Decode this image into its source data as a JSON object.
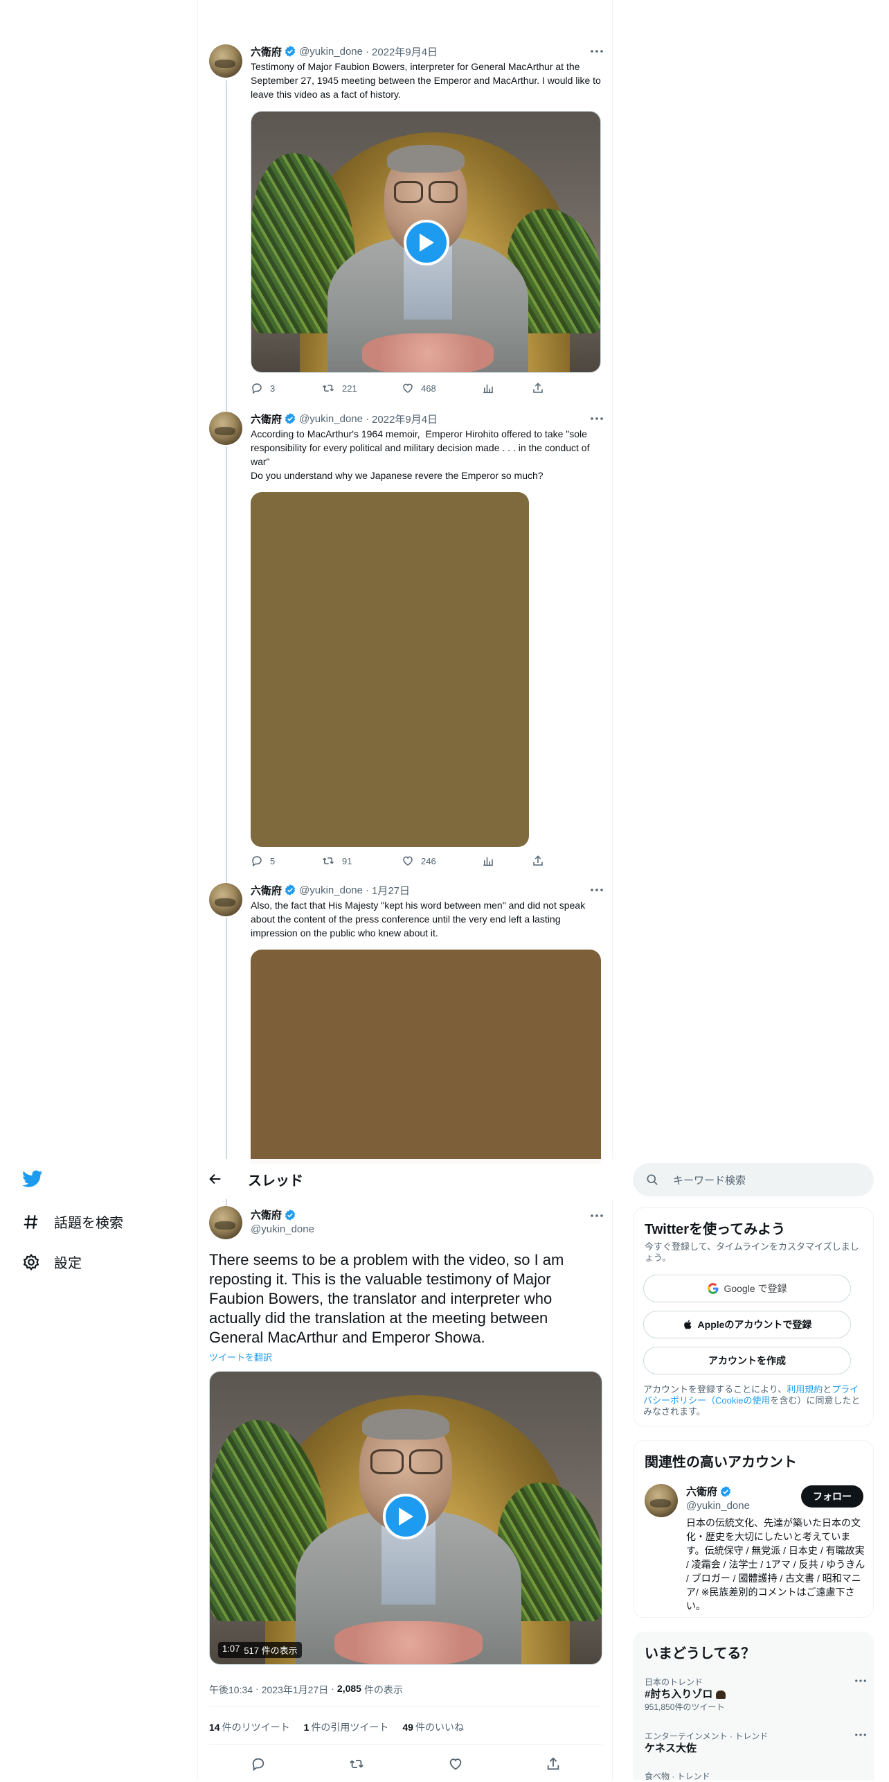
{
  "sidebar": {
    "explore_label": "話題を検索",
    "settings_label": "設定"
  },
  "header": {
    "title": "スレッド"
  },
  "tweets": [
    {
      "name": "六衛府",
      "handle": "@yukin_done",
      "date": "2022年9月4日",
      "text": "Testimony of Major Faubion Bowers, interpreter for General MacArthur at the September 27, 1945 meeting between the Emperor and MacArthur. I would like to leave this video as a fact of history.",
      "replies": "3",
      "retweets": "221",
      "likes": "468"
    },
    {
      "name": "六衛府",
      "handle": "@yukin_done",
      "date": "2022年9月4日",
      "text": "According to MacArthur's 1964 memoir,  Emperor Hirohito offered to take \"sole responsibility for every political and military decision made . . . in the conduct of war\"\nDo you understand why we Japanese revere the Emperor so much?",
      "replies": "5",
      "retweets": "91",
      "likes": "246",
      "media_color": "#7e6a3d"
    },
    {
      "name": "六衛府",
      "handle": "@yukin_done",
      "date": "1月27日",
      "text": "Also, the fact that His Majesty \"kept his word between men\" and did not speak about the content of the press conference until the very end left a lasting impression on the public who knew about it.",
      "media_color": "#7d5f3a"
    }
  ],
  "main_tweet": {
    "name": "六衛府",
    "handle": "@yukin_done",
    "text": "There seems to be a problem with the video, so I am reposting it. This is the valuable testimony of Major Faubion Bowers, the translator and interpreter who actually did the translation at the meeting between General MacArthur and Emperor Showa.",
    "translate": "ツイートを翻訳",
    "video_duration": "1:07",
    "video_views": "517 件の表示",
    "time": "午後10:34",
    "date": "2023年1月27日",
    "views_count": "2,085",
    "views_label": "件の表示",
    "retweets_count": "14",
    "retweets_label": "件のリツイート",
    "quotes_count": "1",
    "quotes_label": "件の引用ツイート",
    "likes_count": "49",
    "likes_label": "件のいいね"
  },
  "search": {
    "placeholder": "キーワード検索"
  },
  "signup": {
    "title": "Twitterを使ってみよう",
    "subtitle": "今すぐ登録して、タイムラインをカスタマイズしましょう。",
    "google": "Google で登録",
    "apple": "Appleのアカウントで登録",
    "create": "アカウントを作成",
    "legal_1": "アカウントを登録することにより、",
    "legal_terms": "利用規約",
    "legal_2": "と",
    "legal_privacy": "プライバシーポリシー（Cookieの使用",
    "legal_3": "を含む）に同意したとみなされます。"
  },
  "relevant": {
    "title": "関連性の高いアカウント",
    "name": "六衛府",
    "handle": "@yukin_done",
    "follow": "フォロー",
    "bio": "日本の伝統文化、先達が築いた日本の文化・歴史を大切にしたいと考えています。伝統保守 / 無党派 / 日本史 / 有職故実 / 凌霜会 / 法学士 / 1アマ / 反共 / ゆうきん / ブロガー / 國體護持 / 古文書 / 昭和マニア/ ※民族差別的コメントはご遠慮下さい。"
  },
  "trends": {
    "title": "いまどうしてる？",
    "items": [
      {
        "context": "日本のトレンド",
        "name": "#討ち入りゾロ",
        "count": "951,850件のツイート"
      },
      {
        "context": "エンターテインメント · トレンド",
        "name": "ケネス大佐",
        "count": ""
      },
      {
        "context": "食べ物 · トレンド",
        "name": "",
        "count": ""
      }
    ]
  },
  "colors": {
    "accent": "#1d9bf0",
    "text": "#0f1419",
    "muted": "#536471"
  }
}
